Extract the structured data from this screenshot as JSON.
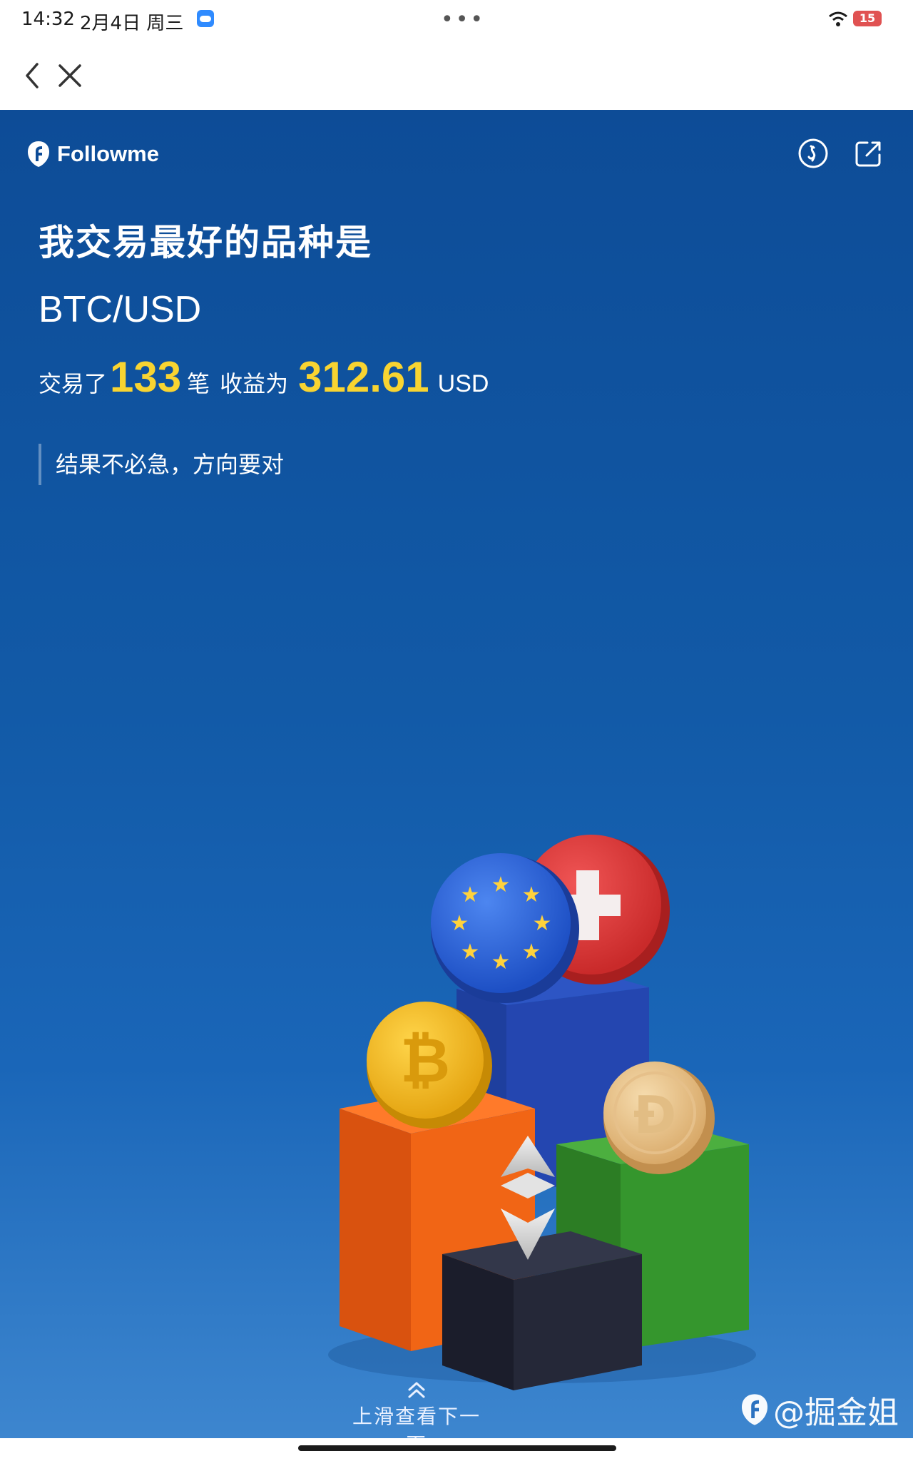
{
  "status_bar": {
    "time": "14:32",
    "date": "2月4日 周三",
    "menu_dots": "•••",
    "battery": "15"
  },
  "app": {
    "brand": "Followme"
  },
  "summary": {
    "headline": "我交易最好的品种是",
    "symbol": "BTC/USD",
    "trades_prefix": "交易了",
    "trades_count": "133",
    "trades_unit": "笔",
    "profit_prefix": "收益为",
    "profit_value": "312.61",
    "profit_currency": "USD",
    "quote": "结果不必急，方向要对"
  },
  "footer": {
    "swipe_hint": "上滑查看下一页"
  },
  "watermark": {
    "text": "@掘金姐"
  },
  "colors": {
    "background_top": "#0d4c97",
    "background_bottom": "#3d86cf",
    "accent_number": "#f8d431"
  },
  "icons": [
    "chevron-left-icon",
    "close-icon",
    "followme-logo-icon",
    "coin-icon",
    "share-icon",
    "chevron-up-icon",
    "wifi-icon",
    "battery-icon"
  ]
}
